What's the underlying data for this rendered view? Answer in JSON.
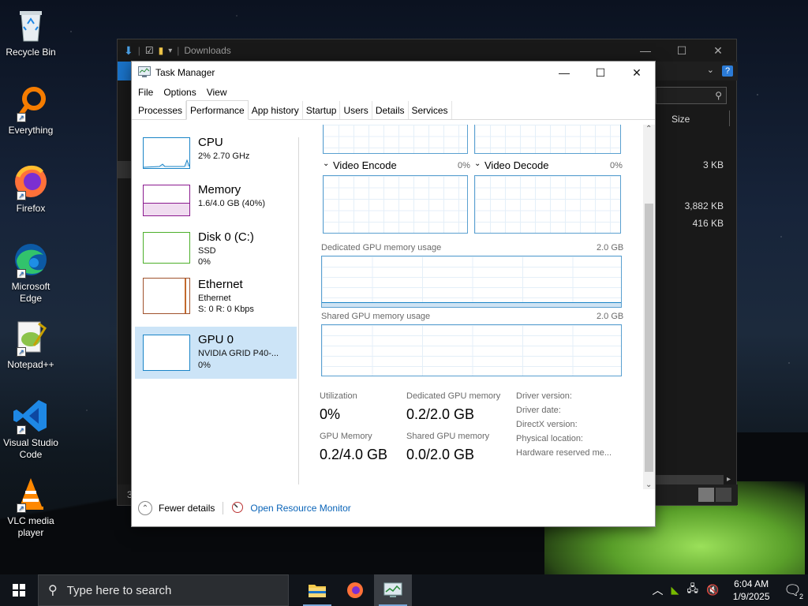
{
  "desktop": {
    "icons": [
      {
        "label": "Recycle Bin"
      },
      {
        "label": "Everything"
      },
      {
        "label": "Firefox"
      },
      {
        "label": "Microsoft Edge"
      },
      {
        "label": "Notepad++"
      },
      {
        "label": "Visual Studio Code"
      },
      {
        "label": "VLC media player"
      }
    ]
  },
  "explorer": {
    "title": "Downloads",
    "column_size": "Size",
    "sizes": [
      "3 KB",
      "3,882 KB",
      "416 KB"
    ],
    "status_count": "3"
  },
  "task_manager": {
    "title": "Task Manager",
    "menu": [
      "File",
      "Options",
      "View"
    ],
    "tabs": [
      "Processes",
      "Performance",
      "App history",
      "Startup",
      "Users",
      "Details",
      "Services"
    ],
    "active_tab": "Performance",
    "sidebar": [
      {
        "name": "CPU",
        "line1": "2% 2.70 GHz",
        "line2": ""
      },
      {
        "name": "Memory",
        "line1": "1.6/4.0 GB (40%)",
        "line2": ""
      },
      {
        "name": "Disk 0 (C:)",
        "line1": "SSD",
        "line2": "0%"
      },
      {
        "name": "Ethernet",
        "line1": "Ethernet",
        "line2": "S: 0 R: 0 Kbps"
      },
      {
        "name": "GPU 0",
        "line1": "NVIDIA GRID P40-...",
        "line2": "0%"
      }
    ],
    "gpu": {
      "video_encode": {
        "label": "Video Encode",
        "pct": "0%"
      },
      "video_decode": {
        "label": "Video Decode",
        "pct": "0%"
      },
      "dedicated_label": "Dedicated GPU memory usage",
      "dedicated_max": "2.0 GB",
      "shared_label": "Shared GPU memory usage",
      "shared_max": "2.0 GB",
      "stats": {
        "utilization_label": "Utilization",
        "utilization_value": "0%",
        "dedicated_label": "Dedicated GPU memory",
        "dedicated_value": "0.2/2.0 GB",
        "gpu_memory_label": "GPU Memory",
        "gpu_memory_value": "0.2/4.0 GB",
        "shared_label": "Shared GPU memory",
        "shared_value": "0.0/2.0 GB"
      },
      "info": [
        "Driver version:",
        "Driver date:",
        "DirectX version:",
        "Physical location:",
        "Hardware reserved me..."
      ]
    },
    "footer": {
      "fewer_details": "Fewer details",
      "resource_monitor": "Open Resource Monitor"
    }
  },
  "taskbar": {
    "search_placeholder": "Type here to search",
    "time": "6:04 AM",
    "date": "1/9/2025",
    "notifications": "2"
  }
}
